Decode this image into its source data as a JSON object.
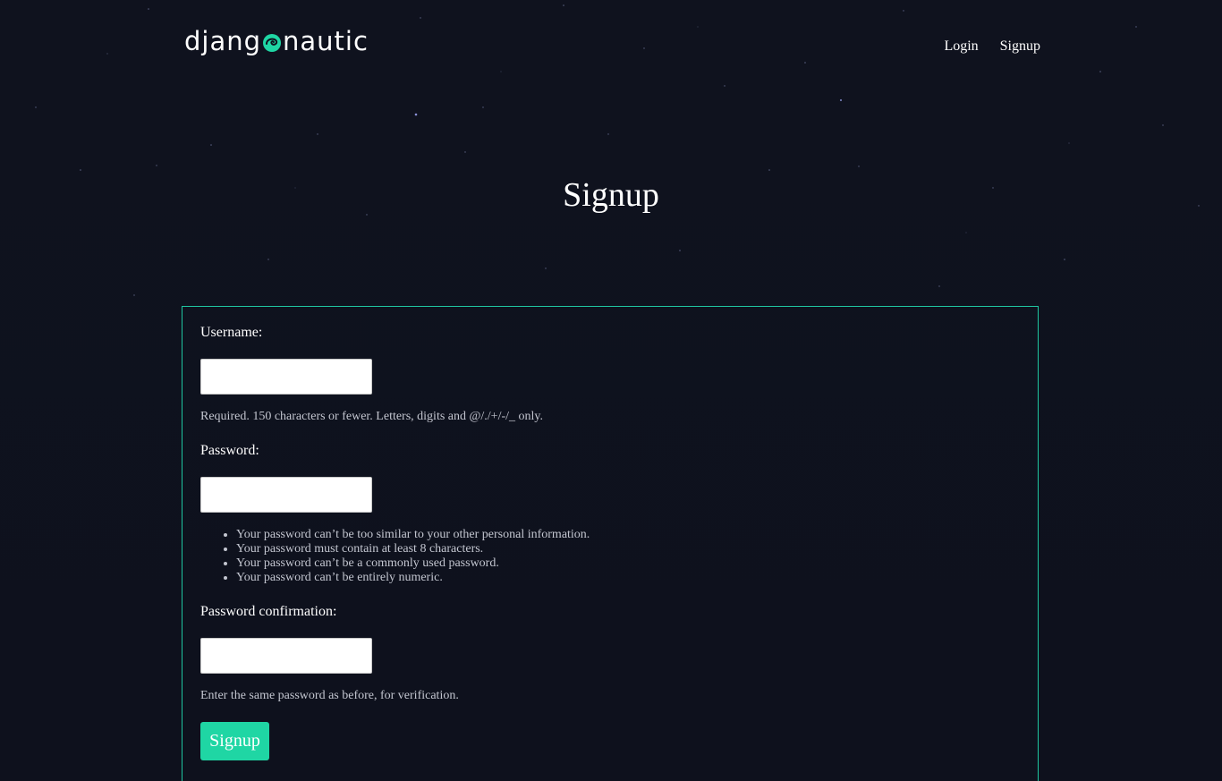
{
  "header": {
    "logo_left": "djang",
    "logo_right": "nautic",
    "nav": {
      "login": "Login",
      "signup": "Signup"
    }
  },
  "page": {
    "title": "Signup"
  },
  "form": {
    "username": {
      "label": "Username:",
      "value": "",
      "help": "Required. 150 characters or fewer. Letters, digits and @/./+/-/_ only."
    },
    "password": {
      "label": "Password:",
      "value": "",
      "rules": [
        "Your password can’t be too similar to your other personal information.",
        "Your password must contain at least 8 characters.",
        "Your password can’t be a commonly used password.",
        "Your password can’t be entirely numeric."
      ]
    },
    "password_confirmation": {
      "label": "Password confirmation:",
      "value": "",
      "help": "Enter the same password as before, for verification."
    },
    "submit_label": "Signup"
  },
  "colors": {
    "background": "#0e111d",
    "accent": "#1fd6a4",
    "card_border": "#1fc5a0",
    "help_text": "#c3c6d0"
  }
}
